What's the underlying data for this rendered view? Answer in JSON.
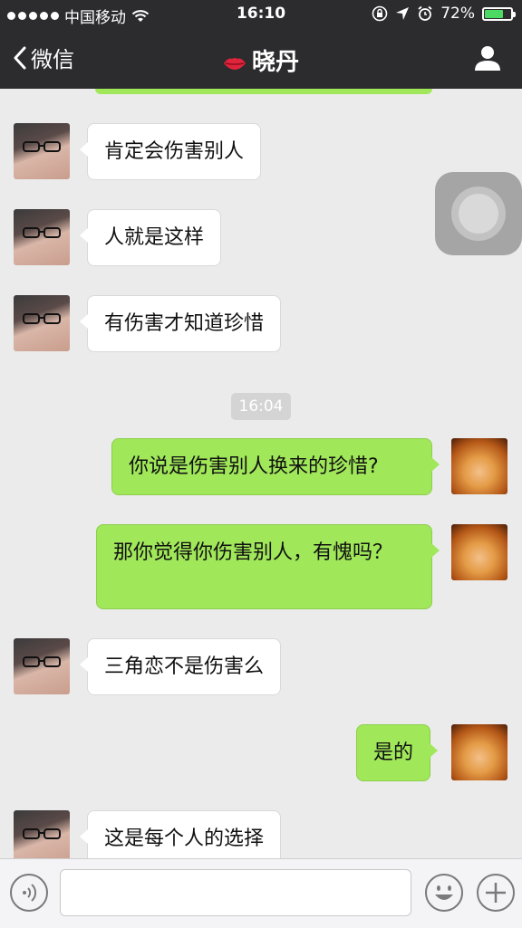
{
  "status_bar": {
    "carrier": "中国移动",
    "time": "16:10",
    "battery_percent": "72%",
    "battery_level": 0.72,
    "icons": [
      "signal-dots-icon",
      "wifi-icon",
      "orientation-lock-icon",
      "location-icon",
      "alarm-icon",
      "battery-icon"
    ]
  },
  "nav": {
    "back_label": "微信",
    "title": "晓丹",
    "title_icon": "lips-icon",
    "profile_icon": "person-icon"
  },
  "messages": [
    {
      "from": "contact",
      "text": "肯定会伤害别人"
    },
    {
      "from": "contact",
      "text": "人就是这样"
    },
    {
      "from": "contact",
      "text": "有伤害才知道珍惜"
    },
    {
      "from": "me",
      "text": "你说是伤害别人换来的珍惜?"
    },
    {
      "from": "me",
      "text": "那你觉得你伤害别人，有愧吗？"
    },
    {
      "from": "contact",
      "text": "三角恋不是伤害么"
    },
    {
      "from": "me",
      "text": "是的"
    },
    {
      "from": "contact",
      "text": "这是每个人的选择"
    }
  ],
  "timestamp": "16:04",
  "input_bar": {
    "voice_icon": "voice-icon",
    "emoji_icon": "emoji-icon",
    "more_icon": "plus-icon",
    "value": ""
  },
  "colors": {
    "bar_bg": "#2c2c2e",
    "chat_bg": "#ebebeb",
    "bubble_out": "#a0e75a",
    "bubble_in": "#ffffff",
    "battery": "#4cd964"
  }
}
